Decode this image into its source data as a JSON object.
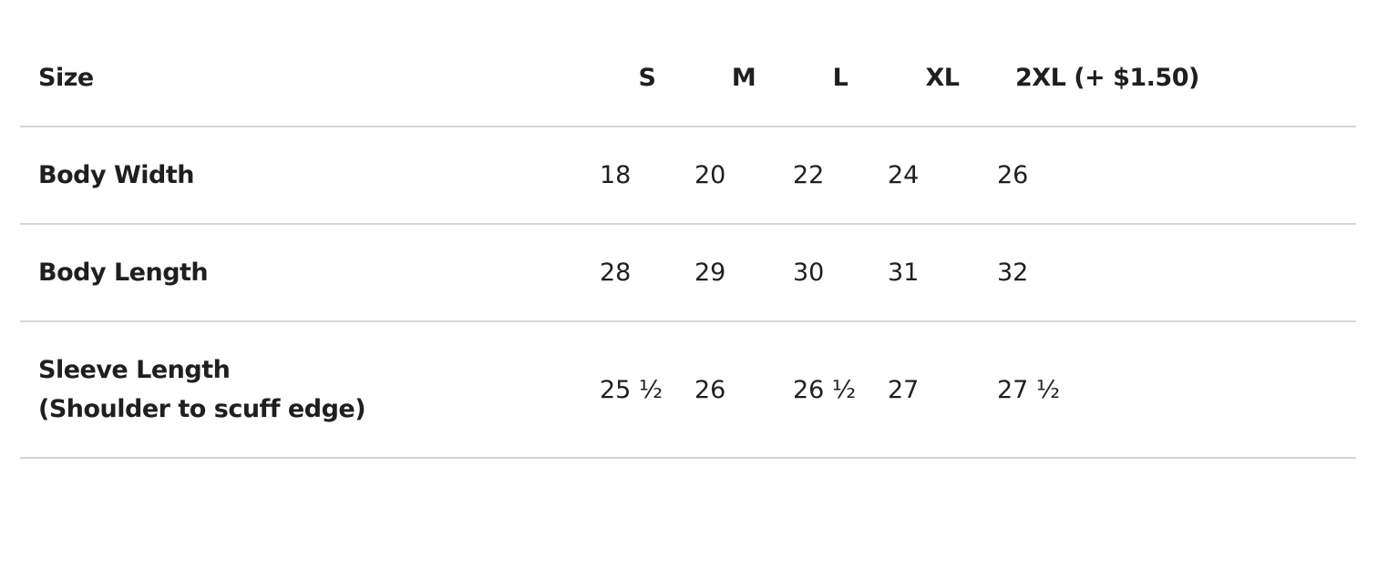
{
  "table": {
    "header": {
      "label": "Size",
      "sizes": [
        "S",
        "M",
        "L",
        "XL",
        "2XL (+ $1.50)"
      ]
    },
    "rows": [
      {
        "label_lines": [
          "Body Width"
        ],
        "values": [
          "18",
          "20",
          "22",
          "24",
          "26"
        ]
      },
      {
        "label_lines": [
          "Body Length"
        ],
        "values": [
          "28",
          "29",
          "30",
          "31",
          "32"
        ]
      },
      {
        "label_lines": [
          "Sleeve Length",
          "(Shoulder to scuff edge)"
        ],
        "values": [
          "25 ½",
          "26",
          "26 ½",
          "27",
          "27 ½"
        ]
      }
    ]
  }
}
